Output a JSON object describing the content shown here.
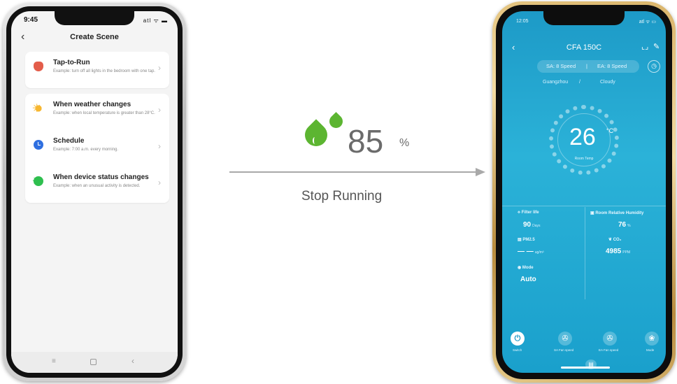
{
  "left_phone": {
    "status_time": "9:45",
    "status_icons": "atl ᯤ ▬",
    "back_icon": "‹",
    "title": "Create Scene",
    "items": [
      {
        "title": "Tap-to-Run",
        "desc": "Example: turn off all lights in the bedroom with one tap.",
        "icon": "hand-tap-icon",
        "color": "#e35d4a"
      },
      {
        "title": "When weather changes",
        "desc": "Example: when local temperature is greater than 28°C.",
        "icon": "sun-icon",
        "color": "#f7b731"
      },
      {
        "title": "Schedule",
        "desc": "Example: 7:00 a.m. every morning.",
        "icon": "clock-icon",
        "color": "#2f6fe0"
      },
      {
        "title": "When device status changes",
        "desc": "Example: when an unusual activity is detected.",
        "icon": "device-icon",
        "color": "#2fbf4f"
      }
    ],
    "chevron": "›",
    "nav": {
      "menu": "≡",
      "back": "‹"
    }
  },
  "middle": {
    "value": "85",
    "unit": "%",
    "caption": "Stop Running",
    "drop_color": "#5cb531"
  },
  "right_phone": {
    "status_time": "12:05",
    "status_icons": "atl ᯤ ▭",
    "back_icon": "‹",
    "title": "CFA 150C",
    "sa_speed": "SA: 8 Speed",
    "separator": "|",
    "ea_speed": "EA: 8 Speed",
    "location": "Guangzhou",
    "loc_sep": "/",
    "weather": "Cloudy",
    "temperature": "26",
    "temp_unit": "°C",
    "temp_label": "Room Temp",
    "stats": {
      "filter_label": "Filter life",
      "filter_value": "90",
      "filter_unit": "Days",
      "humidity_label": "Room Relative Humidity",
      "humidity_value": "76",
      "humidity_unit": "%",
      "pm_label": "PM2.5",
      "pm_value": "— —",
      "pm_unit": "ug/m³",
      "co2_label": "CO₂",
      "co2_value": "4985",
      "co2_unit": "PPM",
      "mode_label": "Mode",
      "mode_value": "Auto"
    },
    "controls": [
      {
        "label": "Switch",
        "icon": "power-icon",
        "glyph": "⏻"
      },
      {
        "label": "SA Fan speed",
        "icon": "fan-icon",
        "glyph": "✇"
      },
      {
        "label": "EA Fan speed",
        "icon": "fan-icon",
        "glyph": "✇"
      },
      {
        "label": "Mode",
        "icon": "mode-icon",
        "glyph": "❀"
      }
    ],
    "extra_glyph": "▤",
    "accent_color": "#1d9ac7"
  }
}
